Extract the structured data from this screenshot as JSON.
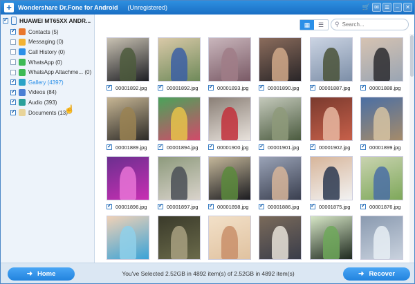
{
  "titlebar": {
    "app_title": "Wondershare Dr.Fone for Android",
    "status": "(Unregistered)",
    "icons": [
      "cart-icon",
      "feedback-icon",
      "menu-icon",
      "minimize-icon",
      "close-icon"
    ]
  },
  "sidebar": {
    "device": "HUAWEI MT65XX ANDR...",
    "items": [
      {
        "label": "Contacts (5)",
        "checked": true,
        "icon": "contacts-icon",
        "color": "#e9762b"
      },
      {
        "label": "Messaging (0)",
        "checked": false,
        "icon": "messaging-icon",
        "color": "#f2b233"
      },
      {
        "label": "Call History (0)",
        "checked": false,
        "icon": "call-history-icon",
        "color": "#2a8fe8"
      },
      {
        "label": "WhatsApp (0)",
        "checked": false,
        "icon": "whatsapp-icon",
        "color": "#3cba54"
      },
      {
        "label": "WhatsApp Attachme... (0)",
        "checked": false,
        "icon": "whatsapp-attachment-icon",
        "color": "#3cba54"
      },
      {
        "label": "Gallery (4397)",
        "checked": true,
        "icon": "gallery-icon",
        "color": "#2aa3c7",
        "selected": true
      },
      {
        "label": "Videos (84)",
        "checked": true,
        "icon": "videos-icon",
        "color": "#4a7fd4"
      },
      {
        "label": "Audio (393)",
        "checked": true,
        "icon": "audio-icon",
        "color": "#2aa09a"
      },
      {
        "label": "Documents (13)",
        "checked": true,
        "icon": "documents-icon",
        "color": "#e8d49a"
      }
    ]
  },
  "toolbar": {
    "search_placeholder": "Search...",
    "view_grid_icon": "grid-view-icon",
    "view_list_icon": "list-view-icon"
  },
  "gallery": {
    "items": [
      {
        "name": "00001892.jpg",
        "checked": true
      },
      {
        "name": "00001892.jpg",
        "checked": true
      },
      {
        "name": "00001893.jpg",
        "checked": true
      },
      {
        "name": "00001890.jpg",
        "checked": true
      },
      {
        "name": "00001887.jpg",
        "checked": true
      },
      {
        "name": "00001888.jpg",
        "checked": true
      },
      {
        "name": "00001889.jpg",
        "checked": true
      },
      {
        "name": "00001894.jpg",
        "checked": true
      },
      {
        "name": "00001900.jpg",
        "checked": true
      },
      {
        "name": "00001901.jpg",
        "checked": true
      },
      {
        "name": "00001902.jpg",
        "checked": true
      },
      {
        "name": "00001899.jpg",
        "checked": true
      },
      {
        "name": "00001896.jpg",
        "checked": true
      },
      {
        "name": "00001897.jpg",
        "checked": true
      },
      {
        "name": "00001898.jpg",
        "checked": true
      },
      {
        "name": "00001886.jpg",
        "checked": true
      },
      {
        "name": "00001875.jpg",
        "checked": true
      },
      {
        "name": "00001876.jpg",
        "checked": true
      },
      {
        "name": "",
        "checked": false
      },
      {
        "name": "",
        "checked": false
      },
      {
        "name": "",
        "checked": false
      },
      {
        "name": "",
        "checked": false
      },
      {
        "name": "",
        "checked": false
      },
      {
        "name": "",
        "checked": false
      }
    ]
  },
  "bottombar": {
    "home_label": "Home",
    "recover_label": "Recover",
    "selection_status": "You've Selected 2.52GB in 4892 item(s) of 2.52GB in 4892 item(s)"
  }
}
